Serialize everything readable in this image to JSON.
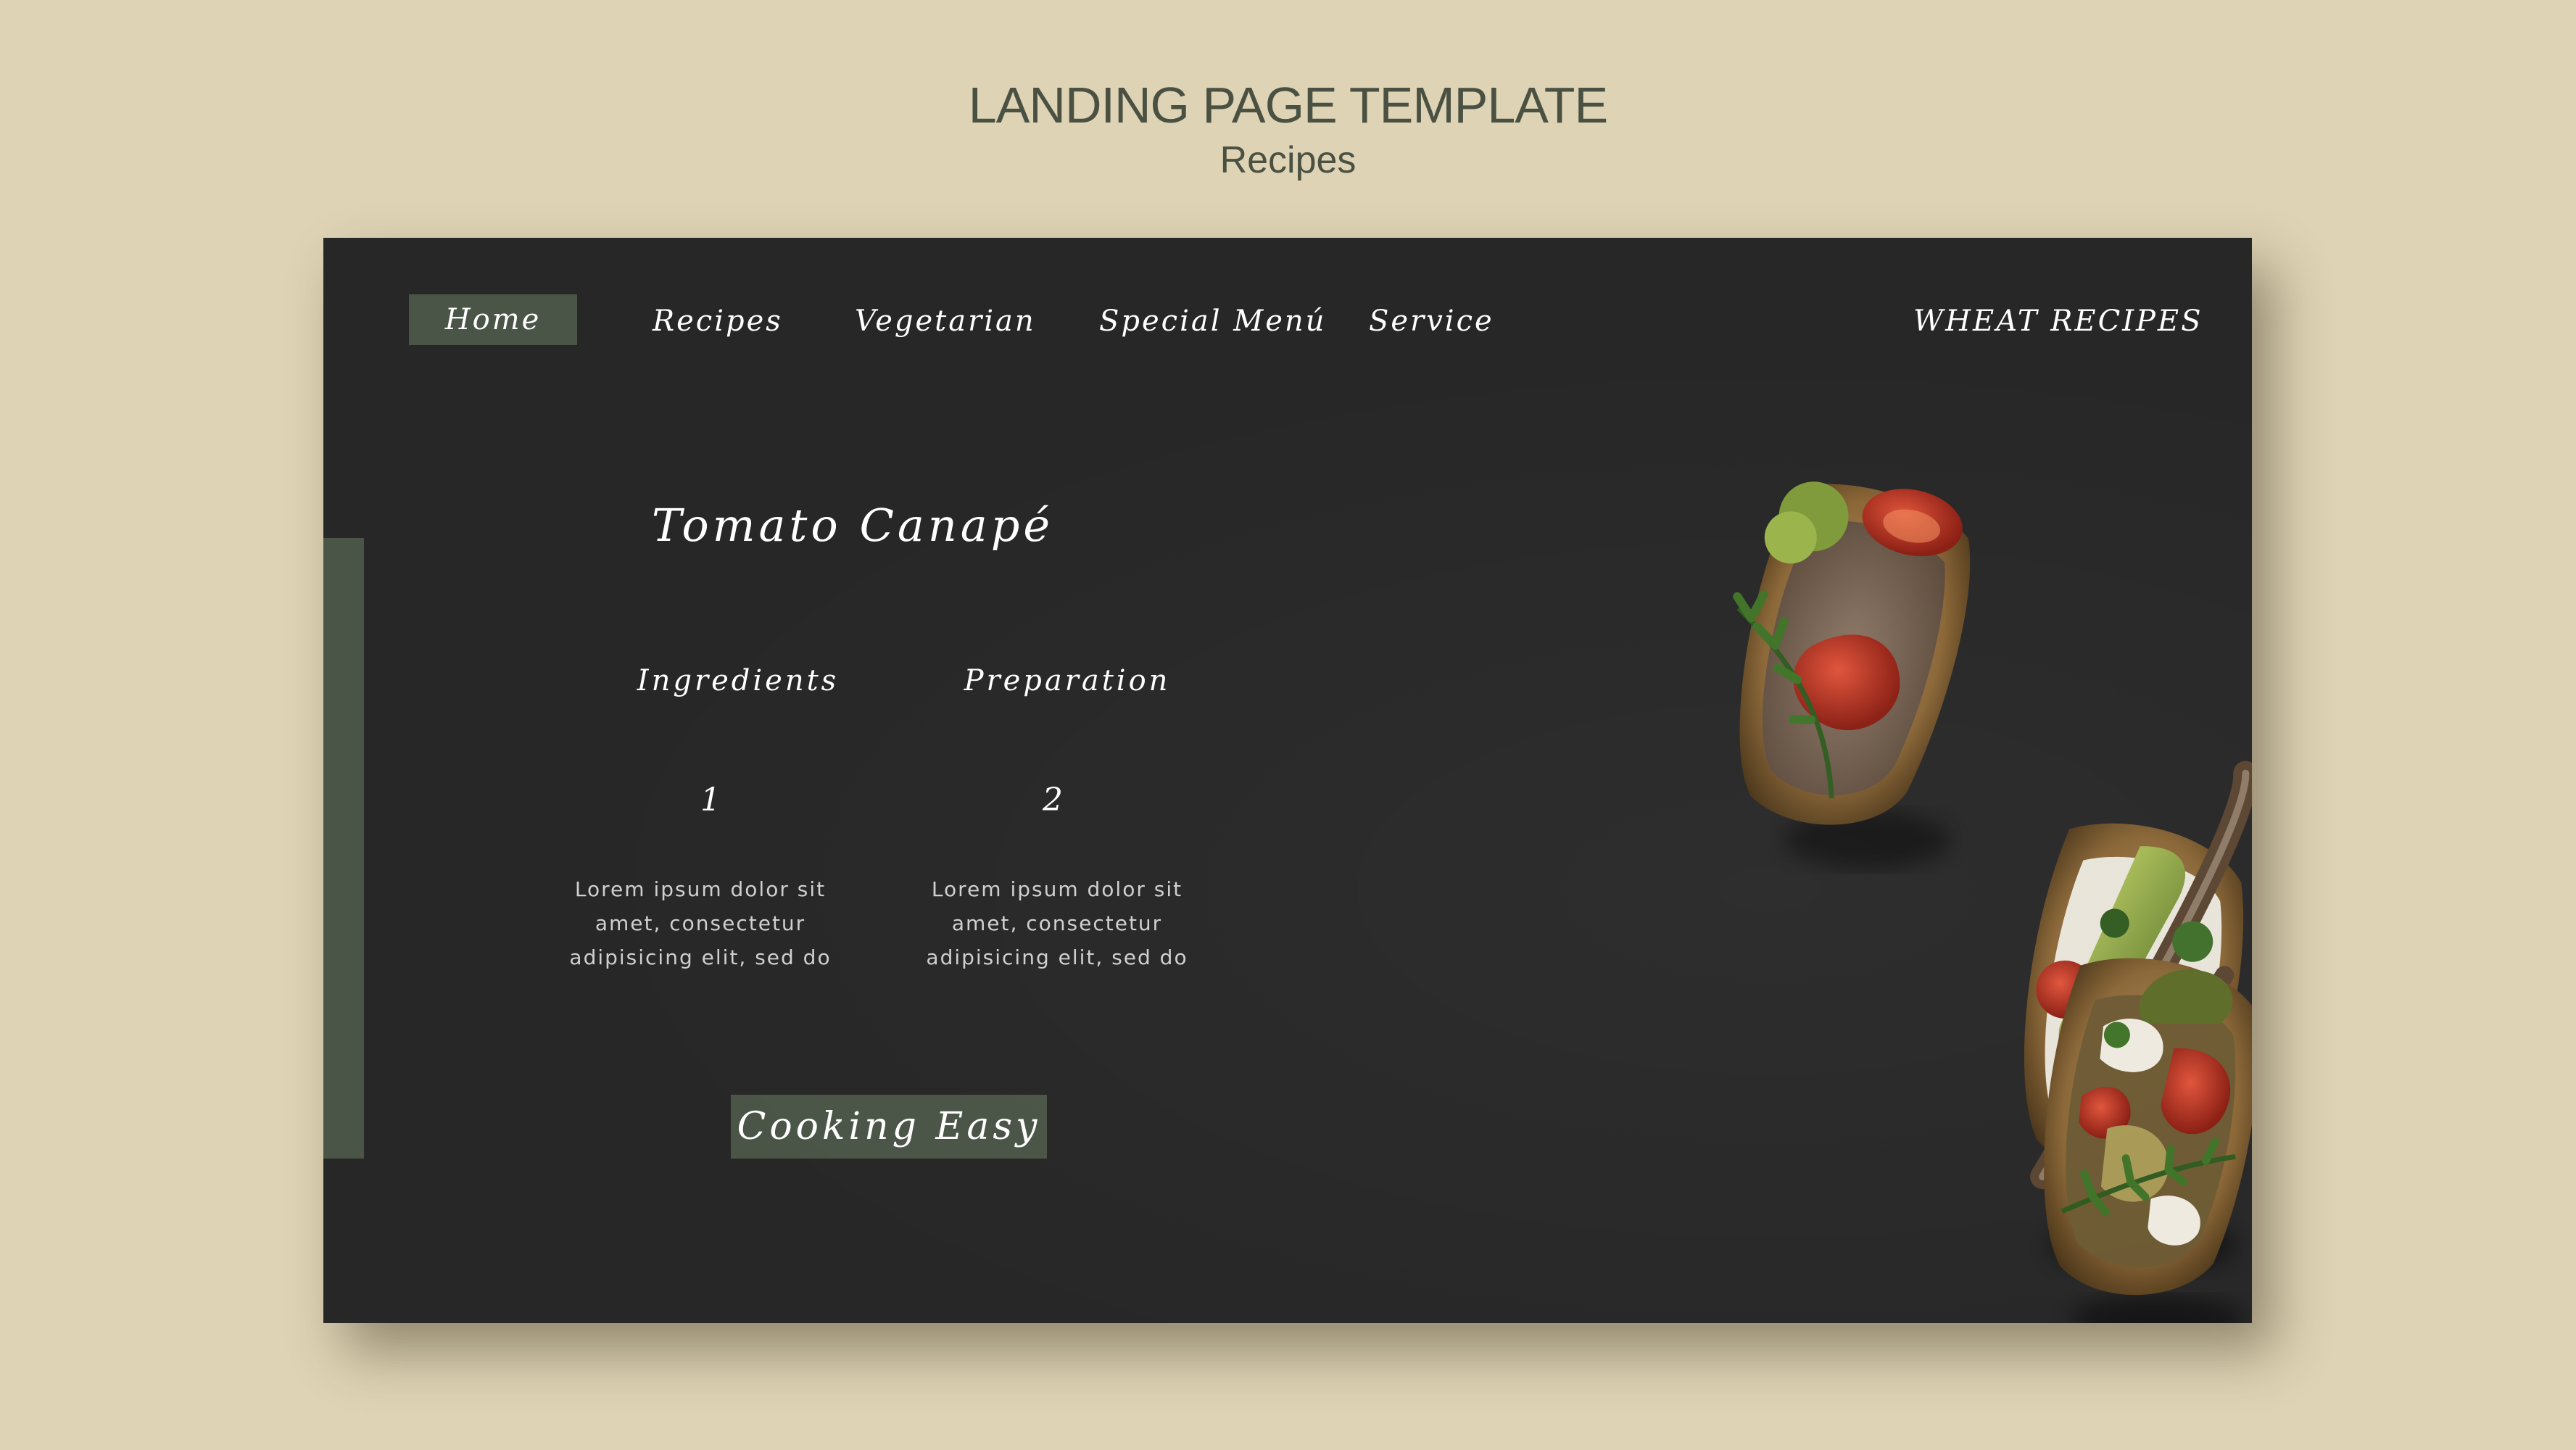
{
  "showcase": {
    "title": "LANDING PAGE TEMPLATE",
    "subtitle": "Recipes"
  },
  "nav": {
    "items": [
      "Home",
      "Recipes",
      "Vegetarian",
      "Special Menú",
      "Service"
    ],
    "brand": "WHEAT RECIPES",
    "active_index": 0
  },
  "hero": {
    "title": "Tomato Canapé",
    "columns": [
      {
        "heading": "Ingredients",
        "number": "1",
        "text_lines": [
          "Lorem ipsum dolor sit",
          "amet, consectetur",
          "adipisicing elit, sed do"
        ]
      },
      {
        "heading": "Preparation",
        "number": "2",
        "text_lines": [
          "Lorem ipsum dolor sit",
          "amet, consectetur",
          "adipisicing elit, sed do"
        ]
      }
    ],
    "cta_label": "Cooking Easy"
  },
  "image": {
    "description_icon": "canape-photo"
  },
  "colors": {
    "page_bg": "#ded3b4",
    "frame_bg": "#272727",
    "accent": "#4a5547",
    "heading_text": "#4a5142"
  }
}
